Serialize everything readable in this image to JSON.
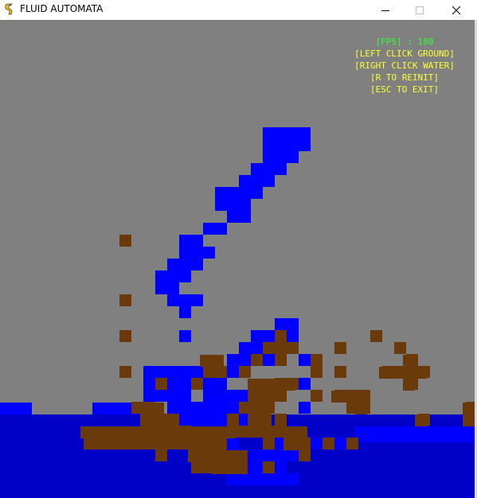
{
  "window": {
    "title": "FLUID AUTOMATA",
    "controls": [
      "minimize",
      "maximize",
      "close"
    ],
    "icon": "pygame-snake-icon"
  },
  "hud": {
    "fps_line": "[FPS] : 180",
    "left_click": "[LEFT CLICK GROUND]",
    "right_click": "[RIGHT CLICK WATER]",
    "reinit": "[R TO REINIT]",
    "exit": "[ESC TO EXIT]"
  },
  "colors": {
    "background": "#808080",
    "water": "#0000ff",
    "deep_water": "#0000c8",
    "ground": "#6b3a0a",
    "fps_text": "#33ff33",
    "hint_text": "#ffff33"
  }
}
